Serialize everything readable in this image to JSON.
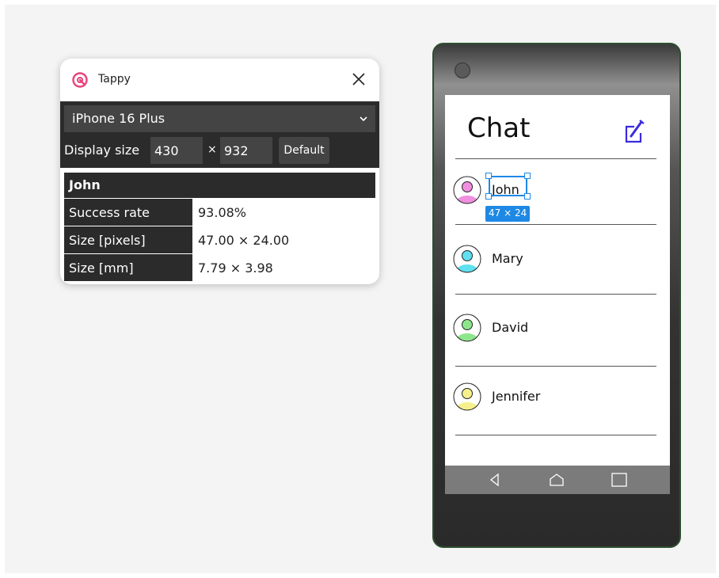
{
  "tappy": {
    "title": "Tappy",
    "device": "iPhone 16 Plus",
    "display_size_label": "Display size",
    "width": "430",
    "height": "932",
    "times": "×",
    "default_label": "Default",
    "selected_element": "John",
    "rows": [
      {
        "key": "Success rate",
        "value": "93.08%"
      },
      {
        "key": "Size [pixels]",
        "value": "47.00 × 24.00"
      },
      {
        "key": "Size [mm]",
        "value": "7.79 × 3.98"
      }
    ]
  },
  "phone": {
    "app_title": "Chat",
    "contacts": [
      {
        "name": "John",
        "avatar_color": "#f08fe0"
      },
      {
        "name": "Mary",
        "avatar_color": "#5fe0ef"
      },
      {
        "name": "David",
        "avatar_color": "#8ee68c"
      },
      {
        "name": "Jennifer",
        "avatar_color": "#f5f08c"
      }
    ],
    "selection_label": "47 × 24"
  },
  "colors": {
    "accent_blue": "#1e88e5",
    "compose_icon": "#3b2be0",
    "tappy_logo": "#e8427c",
    "panel_dark": "#2b2b2b"
  },
  "icons": [
    "tappy-logo-icon",
    "close-icon",
    "chevron-down-icon",
    "compose-icon",
    "person-avatar-icon",
    "back-triangle-icon",
    "home-icon",
    "recents-square-icon"
  ]
}
